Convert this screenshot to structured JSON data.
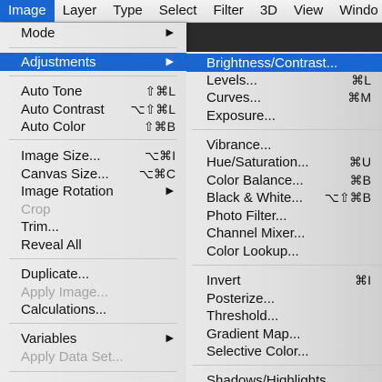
{
  "menubar": {
    "items": [
      "Image",
      "Layer",
      "Type",
      "Select",
      "Filter",
      "3D",
      "View",
      "Windo"
    ]
  },
  "image_menu": {
    "mode": "Mode",
    "adjustments": "Adjustments",
    "auto_tone": "Auto Tone",
    "auto_tone_sc": "⇧⌘L",
    "auto_contrast": "Auto Contrast",
    "auto_contrast_sc": "⌥⇧⌘L",
    "auto_color": "Auto Color",
    "auto_color_sc": "⇧⌘B",
    "image_size": "Image Size...",
    "image_size_sc": "⌥⌘I",
    "canvas_size": "Canvas Size...",
    "canvas_size_sc": "⌥⌘C",
    "image_rotation": "Image Rotation",
    "crop": "Crop",
    "trim": "Trim...",
    "reveal_all": "Reveal All",
    "duplicate": "Duplicate...",
    "apply_image": "Apply Image...",
    "calculations": "Calculations...",
    "variables": "Variables",
    "apply_data_set": "Apply Data Set..."
  },
  "adjustments_menu": {
    "brightness_contrast": "Brightness/Contrast...",
    "levels": "Levels...",
    "levels_sc": "⌘L",
    "curves": "Curves...",
    "curves_sc": "⌘M",
    "exposure": "Exposure...",
    "vibrance": "Vibrance...",
    "hue_saturation": "Hue/Saturation...",
    "hue_saturation_sc": "⌘U",
    "color_balance": "Color Balance...",
    "color_balance_sc": "⌘B",
    "black_white": "Black & White...",
    "black_white_sc": "⌥⇧⌘B",
    "photo_filter": "Photo Filter...",
    "channel_mixer": "Channel Mixer...",
    "color_lookup": "Color Lookup...",
    "invert": "Invert",
    "invert_sc": "⌘I",
    "posterize": "Posterize...",
    "threshold": "Threshold...",
    "gradient_map": "Gradient Map...",
    "selective_color": "Selective Color...",
    "shadows_highlights": "Shadows/Highlights..."
  },
  "icons": {
    "submenu": "submenu-arrow-icon"
  },
  "colors": {
    "highlight": "#1966d2",
    "disabled": "#a3a3a3"
  }
}
